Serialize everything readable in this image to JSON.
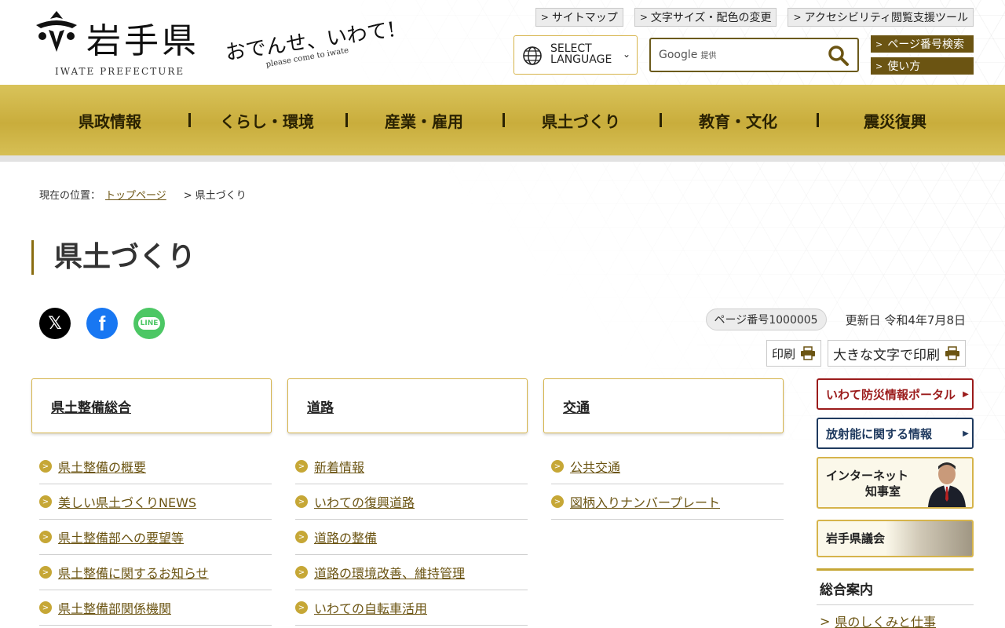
{
  "header": {
    "logo_text": "岩手県",
    "logo_en": "IWATE PREFECTURE",
    "slogan": "おでんせ、いわて!",
    "slogan_sub": "please come to iwate",
    "util_links": [
      "サイトマップ",
      "文字サイズ・配色の変更",
      "アクセシビリティ閲覧支援ツール"
    ],
    "language": {
      "line1": "SELECT",
      "line2": "LANGUAGE"
    },
    "search": {
      "brand": "Google",
      "suffix": "提供"
    },
    "side_buttons": [
      "ページ番号検索",
      "使い方"
    ]
  },
  "gnav": [
    "県政情報",
    "くらし・環境",
    "産業・雇用",
    "県土づくり",
    "教育・文化",
    "震災復興"
  ],
  "breadcrumb": {
    "prefix": "現在の位置：",
    "top": "トップページ",
    "current": "> 県土づくり"
  },
  "page": {
    "title": "県土づくり",
    "page_number": "ページ番号1000005",
    "updated": "更新日 令和4年7月8日",
    "print": "印刷",
    "print_large": "大きな文字で印刷"
  },
  "social": {
    "line_label": "LINE"
  },
  "categories": [
    {
      "title": "県土整備総合",
      "links": [
        "県土整備の概要",
        "美しい県土づくりNEWS",
        "県土整備部への要望等",
        "県土整備に関するお知らせ",
        "県土整備部関係機関"
      ]
    },
    {
      "title": "道路",
      "links": [
        "新着情報",
        "いわての復興道路",
        "道路の整備",
        "道路の環境改善、維持管理",
        "いわての自転車活用"
      ]
    },
    {
      "title": "交通",
      "links": [
        "公共交通",
        "図柄入りナンバープレート"
      ]
    }
  ],
  "sidebar": {
    "bousai": "いわて防災情報ポータル",
    "houshanou": "放射能に関する情報",
    "chiji": {
      "line1": "インターネット",
      "line2": "知事室"
    },
    "gikai": "岩手県議会",
    "guide_head": "総合案内",
    "guide_link": "県のしくみと仕事"
  },
  "colors": {
    "gold": "#c9ad3c",
    "brown": "#6b5412",
    "red": "#9b1b1b",
    "navy": "#1f3a5f"
  }
}
